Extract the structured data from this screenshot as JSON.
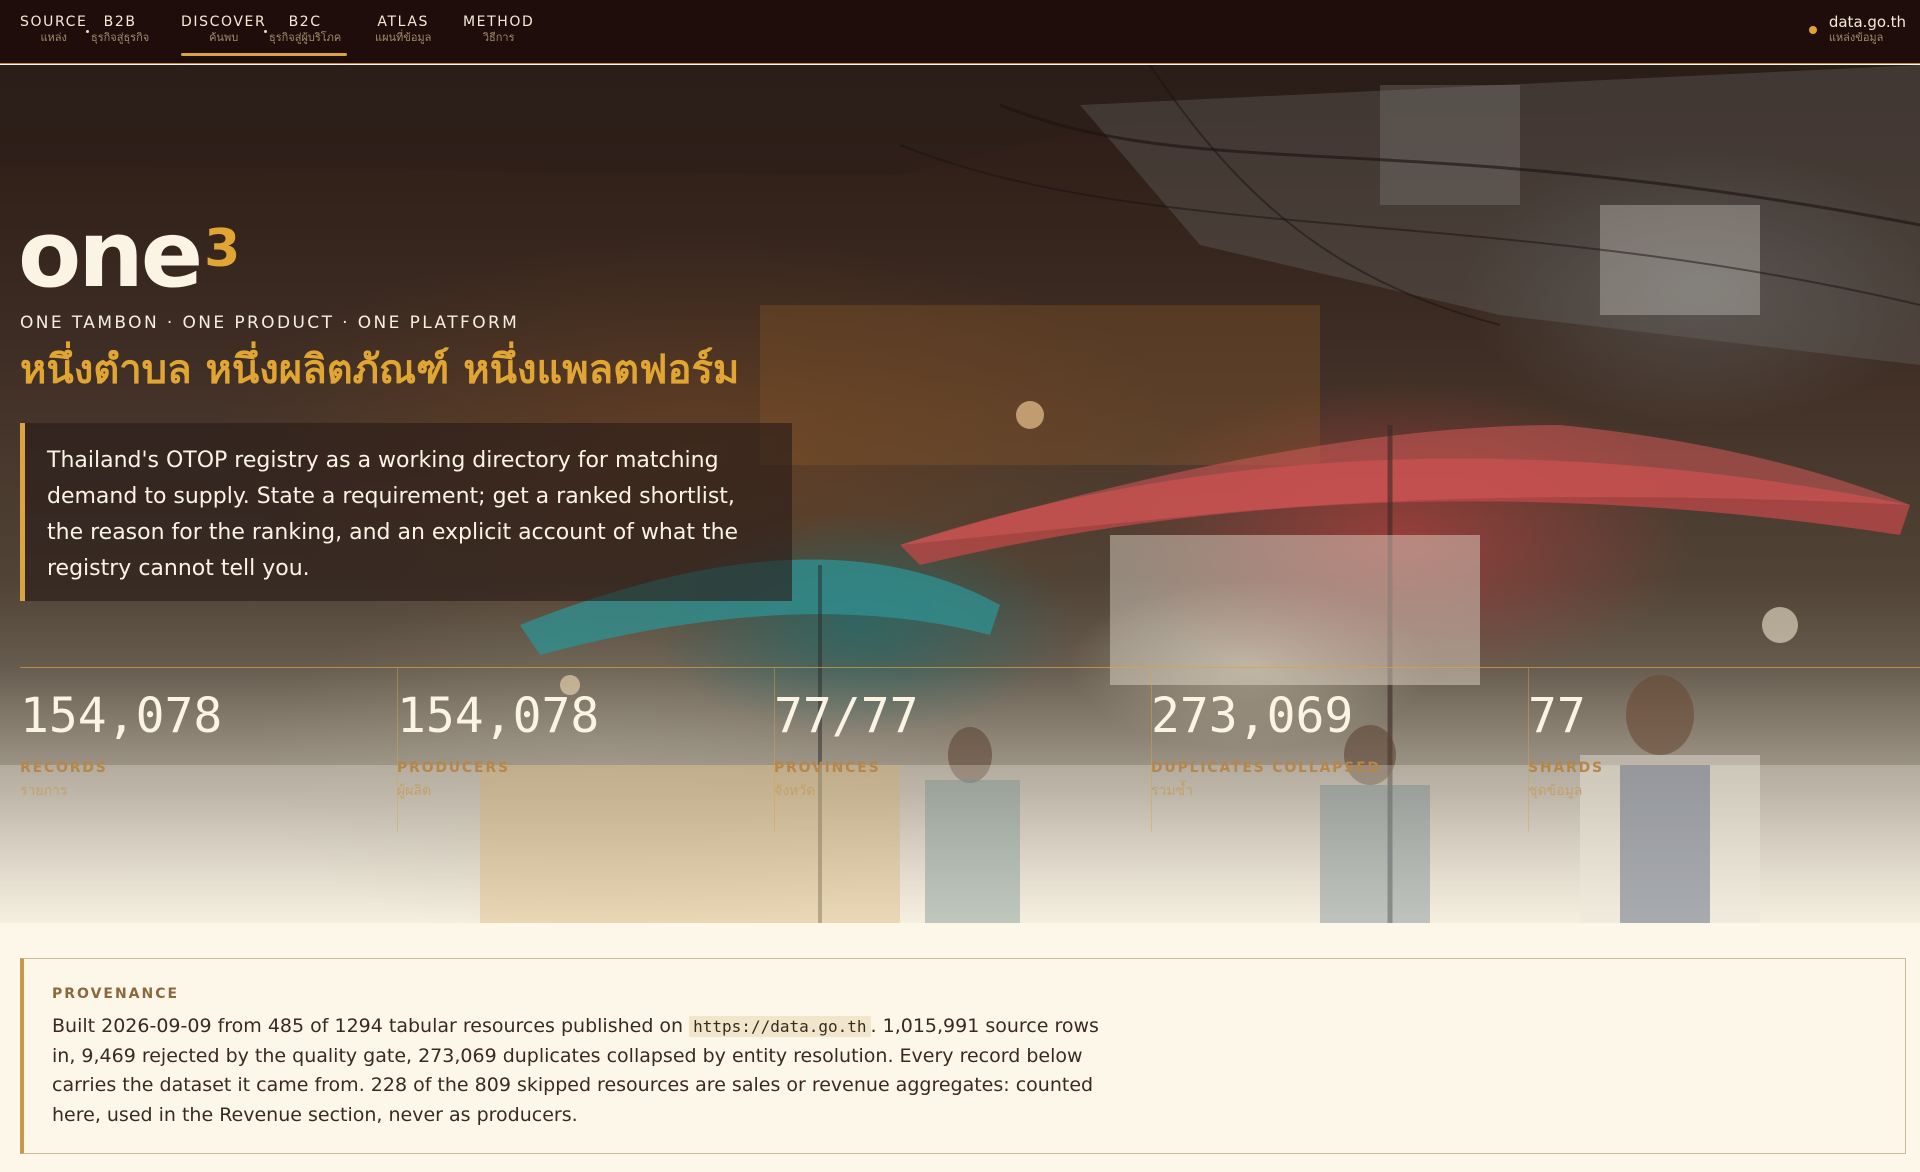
{
  "nav": {
    "items": [
      {
        "en": "SOURCE",
        "th": "แหล่ง"
      },
      {
        "en": "B2B",
        "th": "ธุรกิจสู่ธุรกิจ"
      },
      {
        "en": "DISCOVER",
        "th": "ค้นพบ"
      },
      {
        "en": "B2C",
        "th": "ธุรกิจสู่ผู้บริโภค"
      },
      {
        "en": "ATLAS",
        "th": "แผนที่ข้อมูล"
      },
      {
        "en": "METHOD",
        "th": "วิธีการ"
      }
    ],
    "source_link": {
      "en": "data.go.th",
      "th": "แหล่งข้อมูล"
    },
    "accent": "#d9a441"
  },
  "hero": {
    "logo_text": "one",
    "logo_sup": "3",
    "tagline_en": "ONE TAMBON · ONE PRODUCT · ONE PLATFORM",
    "tagline_th": "หนึ่งตำบล หนึ่งผลิตภัณฑ์ หนึ่งแพลตฟอร์ม",
    "intro": "Thailand's OTOP registry as a working directory for matching demand to supply. State a requirement; get a ranked shortlist, the reason for the ranking, and an explicit account of what the registry cannot tell you."
  },
  "stats": [
    {
      "value": "154,078",
      "label": "RECORDS",
      "label_th": "รายการ"
    },
    {
      "value": "154,078",
      "label": "PRODUCERS",
      "label_th": "ผู้ผลิต"
    },
    {
      "value": "77/77",
      "label": "PROVINCES",
      "label_th": "จังหวัด"
    },
    {
      "value": "273,069",
      "label": "DUPLICATES COLLAPSED",
      "label_th": "รวมซ้ำ"
    },
    {
      "value": "77",
      "label": "SHARDS",
      "label_th": "ชุดข้อมูล"
    }
  ],
  "provenance": {
    "title": "PROVENANCE",
    "text_before": "Built 2026-09-09 from 485 of 1294 tabular resources published on ",
    "url": "https://data.go.th",
    "text_after": ". 1,015,991 source rows in, 9,469 rejected by the quality gate, 273,069 duplicates collapsed by entity resolution. Every record below carries the dataset it came from. 228 of the 809 skipped resources are sales or revenue aggregates: counted here, used in the Revenue section, never as producers."
  }
}
